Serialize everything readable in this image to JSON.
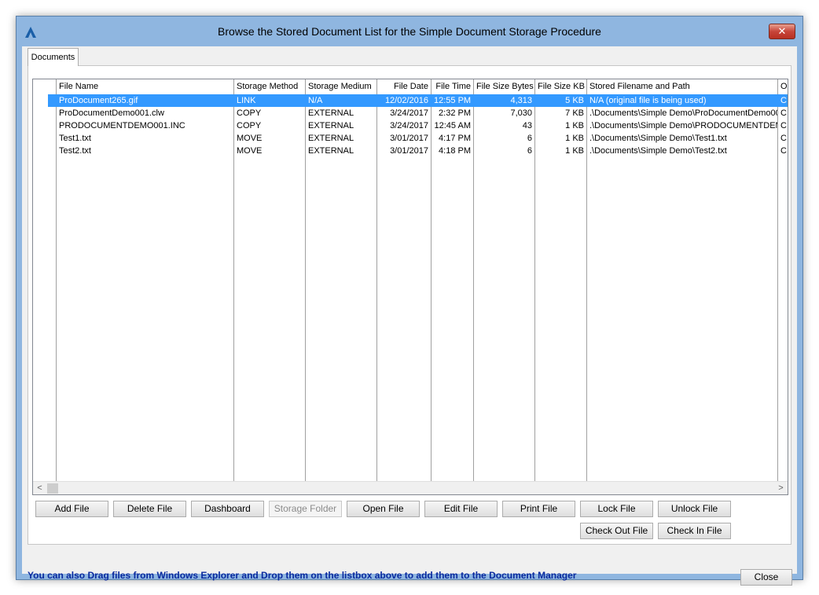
{
  "window": {
    "title": "Browse the Stored Document List for the Simple Document Storage Procedure",
    "close_glyph": "✕",
    "brand_color": "#1a5fa8"
  },
  "tabs": [
    {
      "label": "Documents",
      "selected": true
    }
  ],
  "table": {
    "columns": [
      "File Name",
      "Storage Method",
      "Storage Medium",
      "File Date",
      "File Time",
      "File Size Bytes",
      "File Size KB",
      "Stored Filename and Path",
      "O"
    ],
    "rows": [
      [
        "ProDocument265.gif",
        "LINK",
        "N/A",
        "12/02/2016",
        "12:55 PM",
        "4,313",
        "5 KB",
        "N/A (original file is being used)",
        "C"
      ],
      [
        "ProDocumentDemo001.clw",
        "COPY",
        "EXTERNAL",
        "3/24/2017",
        "2:32 PM",
        "7,030",
        "7 KB",
        ".\\Documents\\Simple Demo\\ProDocumentDemo00",
        "C"
      ],
      [
        "PRODOCUMENTDEMO001.INC",
        "COPY",
        "EXTERNAL",
        "3/24/2017",
        "12:45 AM",
        "43",
        "1 KB",
        ".\\Documents\\Simple Demo\\PRODOCUMENTDEM",
        "C"
      ],
      [
        "Test1.txt",
        "MOVE",
        "EXTERNAL",
        "3/01/2017",
        "4:17 PM",
        "6",
        "1 KB",
        ".\\Documents\\Simple Demo\\Test1.txt",
        "C"
      ],
      [
        "Test2.txt",
        "MOVE",
        "EXTERNAL",
        "3/01/2017",
        "4:18 PM",
        "6",
        "1 KB",
        ".\\Documents\\Simple Demo\\Test2.txt",
        "C"
      ]
    ],
    "selected_row": 0,
    "selection_color": "#3399ff"
  },
  "scrollbar": {
    "left_glyph": "<",
    "right_glyph": ">"
  },
  "buttons": {
    "add_file": "Add File",
    "delete_file": "Delete File",
    "dashboard": "Dashboard",
    "storage_folder": "Storage Folder",
    "open_file": "Open File",
    "edit_file": "Edit File",
    "print_file": "Print File",
    "lock_file": "Lock File",
    "unlock_file": "Unlock File",
    "check_out_file": "Check Out File",
    "check_in_file": "Check In File",
    "close": "Close"
  },
  "hint": {
    "text": "You can also Drag files from Windows Explorer and Drop them on the listbox above to add them to the Document Manager",
    "color": "#0a2a9e"
  }
}
